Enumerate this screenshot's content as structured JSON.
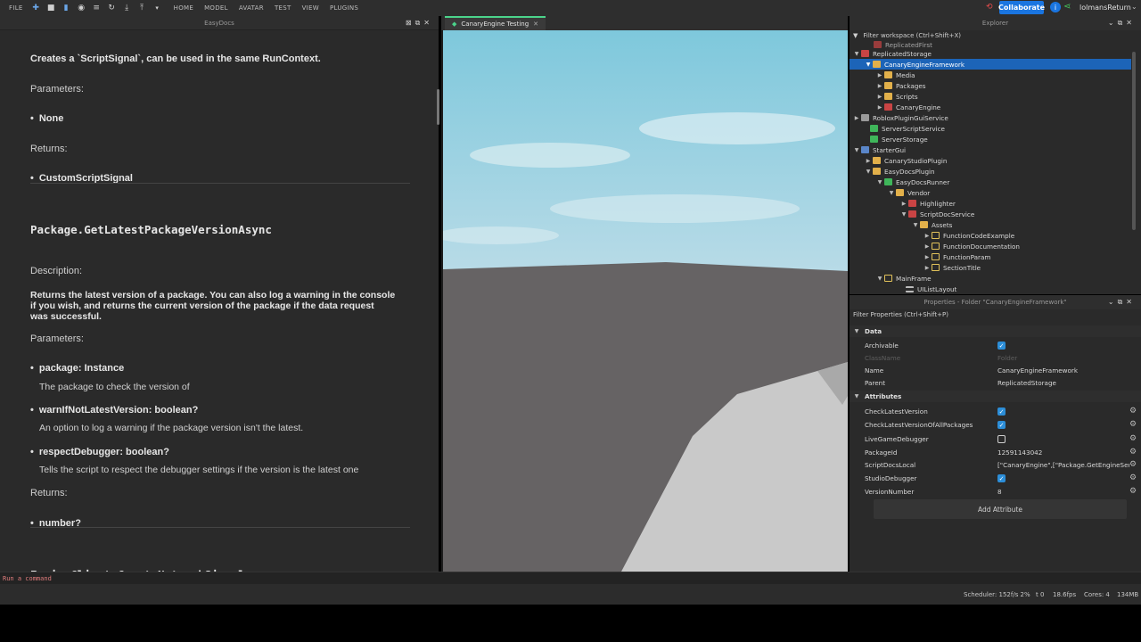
{
  "topbar": {
    "file": "FILE",
    "tabs": [
      "HOME",
      "MODEL",
      "AVATAR",
      "TEST",
      "VIEW",
      "PLUGINS"
    ],
    "collaborate": "Collaborate",
    "username": "lolmansReturn"
  },
  "docs": {
    "panel_title": "EasyDocs",
    "intro": "Creates a `ScriptSignal`, can be used in the same RunContext.",
    "params_label": "Parameters:",
    "param_none": "None",
    "returns_label": "Returns:",
    "return_type_1": "CustomScriptSignal",
    "func_title_1": "Package.GetLatestPackageVersionAsync",
    "description_label": "Description:",
    "description_line1": "Returns the latest version of a package. You can also log a warning in the console",
    "description_line2": "if you wish, and returns the current version of the package if the data request",
    "description_line3": "was successful.",
    "params_label_2": "Parameters:",
    "param1_name": "package: Instance",
    "param1_desc": "The package to check the version of",
    "param2_name": "warnIfNotLatestVersion: boolean?",
    "param2_desc": "An option to log a warning if the package version isn't the latest.",
    "param3_name": "respectDebugger: boolean?",
    "param3_desc": "Tells the script to respect the debugger settings if the version is the latest one",
    "returns_label_2": "Returns:",
    "return_type_2": "number?",
    "func_title_2": "EngineClient.CreateNetworkSignal"
  },
  "viewport": {
    "tab_label": "CanaryEngine Testing",
    "colors": {
      "sky_top": "#7ec8dc",
      "sky_bottom": "#b8dbe7",
      "ground": "#666364"
    }
  },
  "explorer": {
    "title": "Explorer",
    "filter_placeholder": "Filter workspace (Ctrl+Shift+X)",
    "rows": [
      {
        "label": "ReplicatedFirst"
      },
      {
        "label": "ReplicatedStorage"
      },
      {
        "label": "CanaryEngineFramework"
      },
      {
        "label": "Media"
      },
      {
        "label": "Packages"
      },
      {
        "label": "Scripts"
      },
      {
        "label": "CanaryEngine"
      },
      {
        "label": "RobloxPluginGuiService"
      },
      {
        "label": "ServerScriptService"
      },
      {
        "label": "ServerStorage"
      },
      {
        "label": "StarterGui"
      },
      {
        "label": "CanaryStudioPlugin"
      },
      {
        "label": "EasyDocsPlugin"
      },
      {
        "label": "EasyDocsRunner"
      },
      {
        "label": "Vendor"
      },
      {
        "label": "Highlighter"
      },
      {
        "label": "ScriptDocService"
      },
      {
        "label": "Assets"
      },
      {
        "label": "FunctionCodeExample"
      },
      {
        "label": "FunctionDocumentation"
      },
      {
        "label": "FunctionParam"
      },
      {
        "label": "SectionTitle"
      },
      {
        "label": "MainFrame"
      },
      {
        "label": "UIListLayout"
      }
    ]
  },
  "properties": {
    "title": "Properties - Folder \"CanaryEngineFramework\"",
    "filter_placeholder": "Filter Properties (Ctrl+Shift+P)",
    "section_data": "Data",
    "archivable": "Archivable",
    "classname_label": "ClassName",
    "classname_value": "Folder",
    "name_label": "Name",
    "name_value": "CanaryEngineFramework",
    "parent_label": "Parent",
    "parent_value": "ReplicatedStorage",
    "section_attributes": "Attributes",
    "attributes": [
      {
        "name": "CheckLatestVersion",
        "value": ""
      },
      {
        "name": "CheckLatestVersionOfAllPackages",
        "value": ""
      },
      {
        "name": "LiveGameDebugger",
        "value": ""
      },
      {
        "name": "PackageId",
        "value": "12591143042"
      },
      {
        "name": "ScriptDocsLocal",
        "value": "[\"CanaryEngine\",[\"Package.GetEngineSer..."
      },
      {
        "name": "StudioDebugger",
        "value": ""
      },
      {
        "name": "VersionNumber",
        "value": "8"
      }
    ],
    "add_attribute": "Add Attribute"
  },
  "command_bar": {
    "placeholder": "Run a command"
  },
  "status": {
    "scheduler": "Scheduler: 152f/s 2%",
    "t0": "t 0",
    "fps": "18.6fps",
    "cores": "Cores: 4",
    "memory": "134MB"
  }
}
